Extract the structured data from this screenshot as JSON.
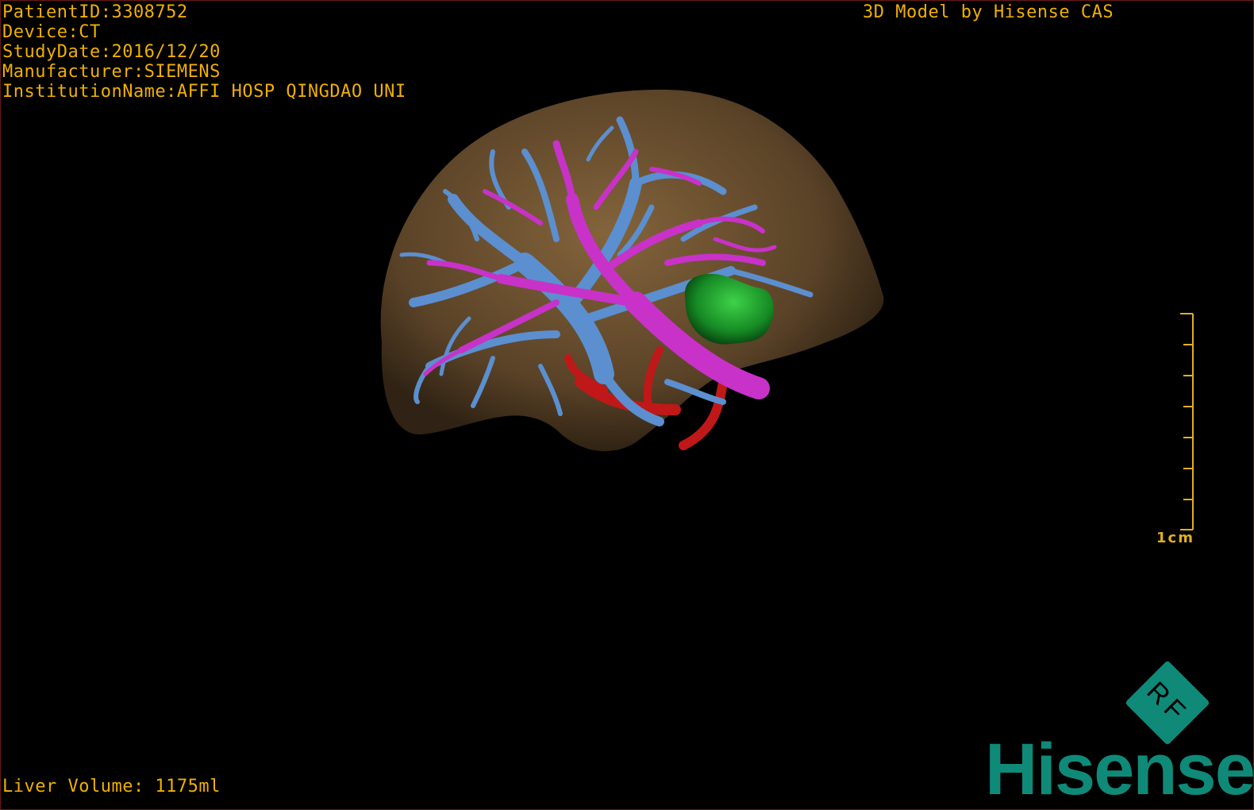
{
  "overlay": {
    "patient_id": "PatientID:3308752",
    "device": "Device:CT",
    "study_date": "StudyDate:2016/12/20",
    "manufacturer": "Manufacturer:SIEMENS",
    "institution": "InstitutionName:AFFI HOSP QINGDAO UNI",
    "credit": "3D Model by Hisense CAS",
    "liver_volume": "Liver Volume: 1175ml",
    "text_color": "#f0b000"
  },
  "scale": {
    "label": "1cm",
    "color": "#e0b020"
  },
  "logo": {
    "badge_text": "RF",
    "brand": "Hisense",
    "color": "#0f8a78"
  },
  "model": {
    "liver_color": "#7a5a33",
    "portal_vein_color": "#c832c8",
    "hepatic_vein_color": "#5b8fd0",
    "artery_color": "#c01818",
    "tumor_color": "#1a9a2a"
  }
}
